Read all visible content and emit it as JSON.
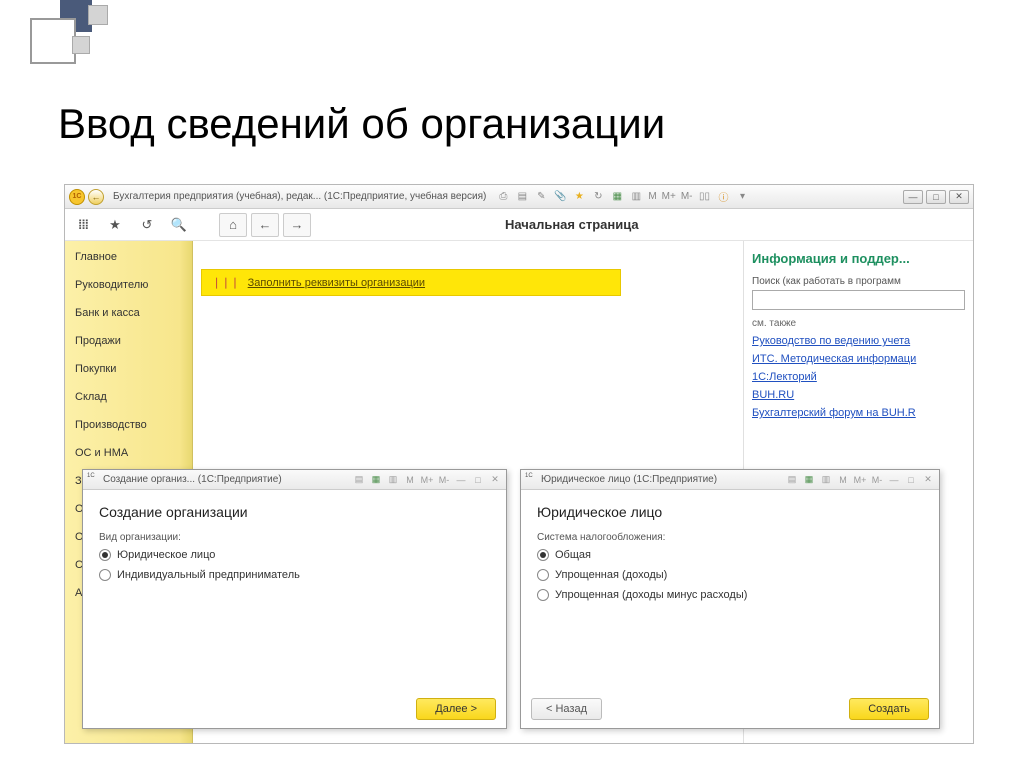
{
  "slide": {
    "title": "Ввод сведений об организации"
  },
  "mainWindow": {
    "titlebar": "Бухгалтерия предприятия (учебная), редак...  (1С:Предприятие, учебная версия)",
    "pageTitle": "Начальная страница"
  },
  "sidebar": {
    "items": [
      "Главное",
      "Руководителю",
      "Банк и касса",
      "Продажи",
      "Покупки",
      "Склад",
      "Производство",
      "ОС и НМА",
      "Зарплата",
      "Операции",
      "Отчеты",
      "Справочн",
      "Администр"
    ]
  },
  "banner": {
    "link": "Заполнить реквизиты организации"
  },
  "rightPanel": {
    "heading": "Информация и поддер...",
    "searchLabel": "Поиск (как работать в программ",
    "also": "см. также",
    "links": [
      "Руководство по ведению учета",
      "ИТС. Методическая информаци",
      "1С:Лекторий",
      "BUH.RU",
      "Бухгалтерский форум на BUH.R"
    ]
  },
  "dialog1": {
    "title": "Создание организ... (1С:Предприятие)",
    "heading": "Создание организации",
    "fieldLabel": "Вид организации:",
    "options": [
      "Юридическое лицо",
      "Индивидуальный предприниматель"
    ],
    "nextBtn": "Далее >"
  },
  "dialog2": {
    "title": "Юридическое лицо (1С:Предприятие)",
    "heading": "Юридическое лицо",
    "fieldLabel": "Система налогообложения:",
    "options": [
      "Общая",
      "Упрощенная (доходы)",
      "Упрощенная (доходы минус расходы)"
    ],
    "backBtn": "< Назад",
    "createBtn": "Создать"
  },
  "memButtons": {
    "m": "M",
    "mplus": "M+",
    "mminus": "M-"
  }
}
